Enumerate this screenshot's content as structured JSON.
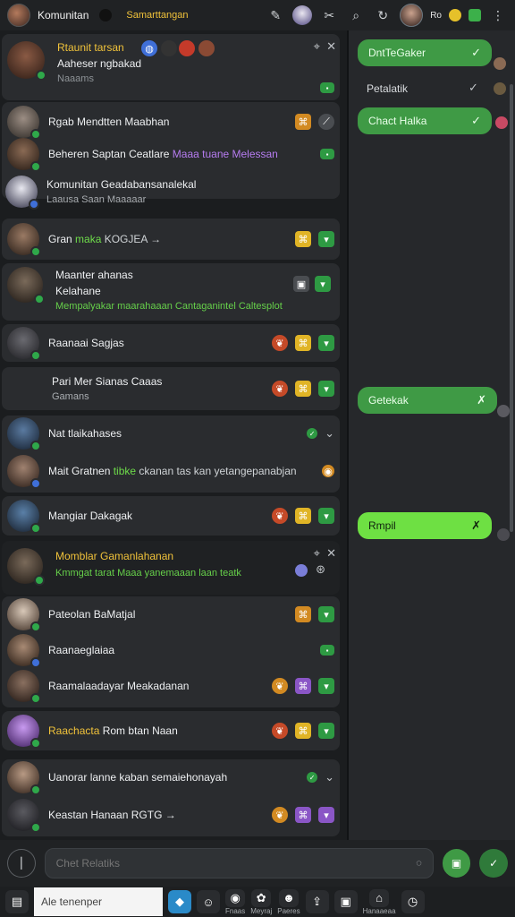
{
  "topbar": {
    "title": "Komunitan",
    "subtitle": "Samarttangan",
    "mini_label": "Ro",
    "icons": [
      "avatar",
      "wand-icon",
      "avatar-group-icon",
      "tools-icon",
      "search-icon",
      "refresh-icon",
      "profile-avatar",
      "coin-icon",
      "grid-icon",
      "more-icon"
    ]
  },
  "list": {
    "card1": {
      "title": "Rtaunit tarsan",
      "line1": "Aaheser ngbakad",
      "line2": "Naaams"
    },
    "item2": {
      "name": "Rgab Mendtten Maabhan"
    },
    "item3": {
      "name": "Beheren Saptan Ceatlare",
      "tag": "Maaa tuane Melessan"
    },
    "item4": {
      "name": "Komunitan Geadabansanalekal",
      "sub": "Laausa Saan Maaaaar"
    },
    "item5": {
      "name": "Gran",
      "tag": "maka",
      "rest": "KOGJEA →"
    },
    "item6": {
      "name": "Maanter ahanas",
      "line2": "Kelahane",
      "line3": "Mempalyakar maarahaaan Cantaganintel Caltesplot"
    },
    "item7": {
      "name": "Raanaai Sagjas"
    },
    "item8": {
      "name": "Pari Mer Sianas Caaas",
      "sub": "Gamans"
    },
    "item9": {
      "name": "Nat tlaikahases"
    },
    "item10": {
      "name": "Mait Gratnen",
      "tag": "tibke",
      "rest": "ckanan tas kan yetangepanabjan"
    },
    "item11": {
      "name": "Mangiar Dakagak"
    },
    "card2": {
      "title": "Momblar Gamanlahanan",
      "line2": "Kmmgat tarat Maaa yanemaaan laan teatk"
    },
    "item12": {
      "name": "Pateolan BaMatjal"
    },
    "item13": {
      "name": "Raanaeglaiaa"
    },
    "item14": {
      "name": "Raamalaadayar Meakadanan"
    },
    "item15": {
      "name": "Raachacta",
      "rest": "Rom btan Naan"
    },
    "item16": {
      "name": "Uanorar lanne kaban semaiehonayah"
    },
    "item17": {
      "name": "Keastan Hanaan RGTG →"
    }
  },
  "chat": {
    "bubble1": "DntTeGaker",
    "plain1": "Petalatik",
    "bubble2": "Chact Halka",
    "bubble3": "Getekak",
    "bubble4": "Rmpil"
  },
  "composer": {
    "placeholder": "Chet Relatiks"
  },
  "dock": {
    "search_placeholder": "Ale tenenper",
    "labels": [
      "Fnaas",
      "Meyraj",
      "Paeres",
      "Hanaaeaa"
    ]
  },
  "colors": {
    "accent_green": "#3f9a45",
    "lime": "#6ee043",
    "highlight_yellow": "#f0c23a",
    "background": "#1b1d1f"
  }
}
